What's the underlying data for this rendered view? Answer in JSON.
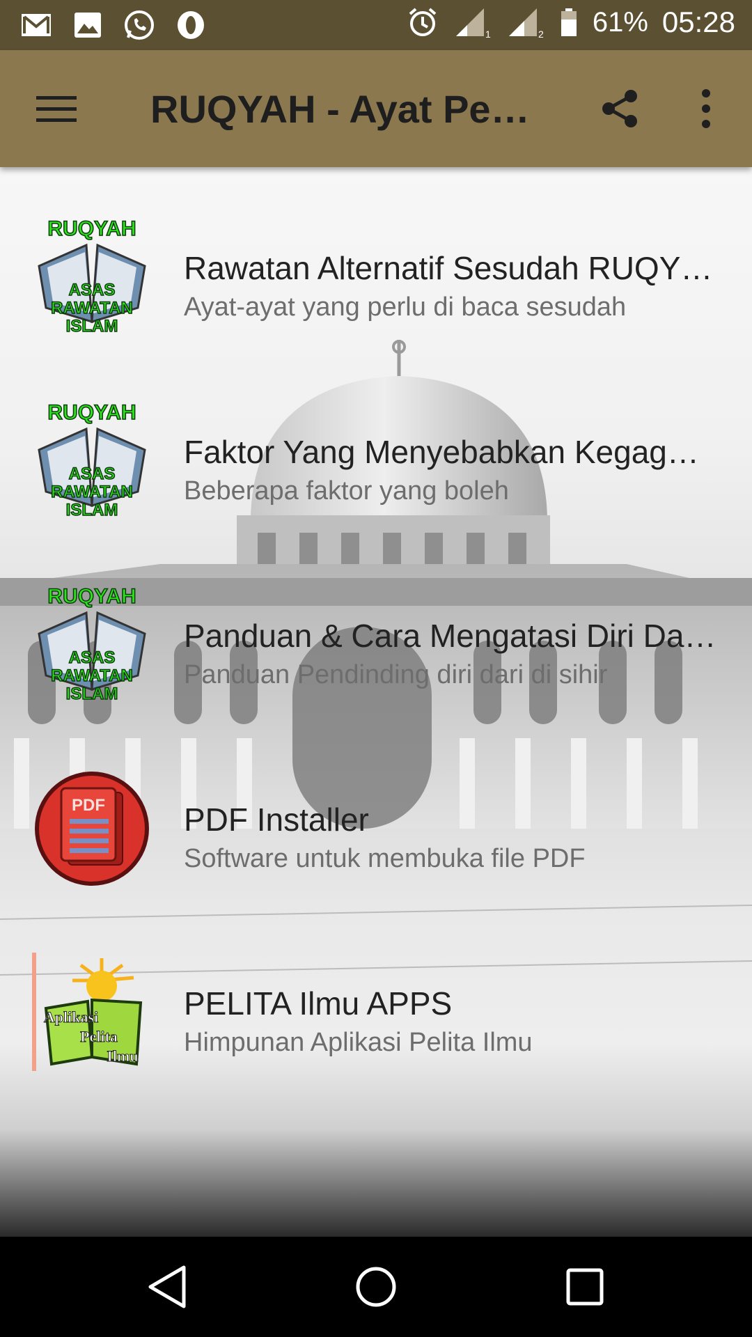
{
  "status_bar": {
    "battery": "61%",
    "time": "05:28",
    "icons": [
      "gmail-icon",
      "gallery-icon",
      "whatsapp-icon",
      "opera-icon",
      "alarm-icon",
      "signal-1-icon",
      "signal-2-icon",
      "battery-icon"
    ],
    "sim1": "1",
    "sim2": "2"
  },
  "app_bar": {
    "title": "RUQYAH - Ayat Pen…",
    "background": "#8b784f",
    "icons": [
      "menu-icon",
      "share-icon",
      "more-vert-icon"
    ]
  },
  "list": {
    "items": [
      {
        "title": "Rawatan Alternatif Sesudah RUQY…",
        "subtitle": "Ayat-ayat yang perlu di baca sesudah",
        "icon": "ruqyah-book-icon",
        "icon_text": [
          "RUQYAH",
          "ASAS",
          "RAWATAN",
          "ISLAM"
        ]
      },
      {
        "title": "Faktor Yang Menyebabkan Kegag…",
        "subtitle": "Beberapa faktor yang boleh",
        "icon": "ruqyah-book-icon",
        "icon_text": [
          "RUQYAH",
          "ASAS",
          "RAWATAN",
          "ISLAM"
        ]
      },
      {
        "title": "Panduan & Cara Mengatasi Diri Da…",
        "subtitle": "Panduan Pendinding diri dari di sihir",
        "icon": "ruqyah-book-icon",
        "icon_text": [
          "RUQYAH",
          "ASAS",
          "RAWATAN",
          "ISLAM"
        ]
      },
      {
        "title": "PDF Installer",
        "subtitle": "Software untuk membuka file PDF",
        "icon": "pdf-icon",
        "icon_text": [
          "PDF"
        ]
      },
      {
        "title": "PELITA Ilmu APPS",
        "subtitle": "Himpunan Aplikasi Pelita Ilmu",
        "icon": "pelita-ilmu-logo-icon",
        "icon_text": [
          "Aplikasi",
          "Pelita",
          "Ilmu"
        ]
      }
    ]
  },
  "nav_bar": {
    "icons": [
      "back-icon",
      "home-icon",
      "recents-icon"
    ]
  }
}
